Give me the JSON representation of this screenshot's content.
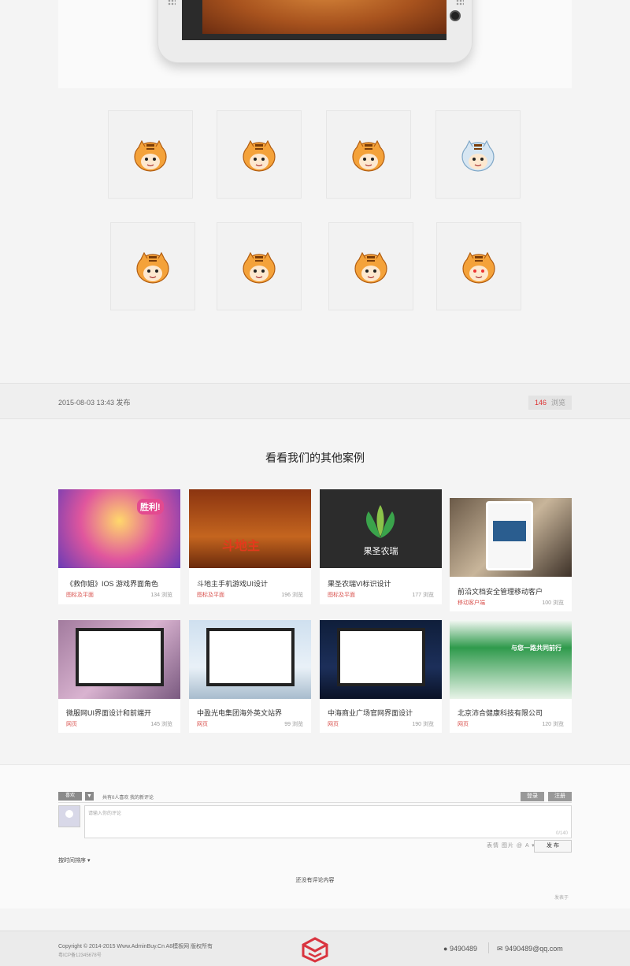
{
  "article": {
    "date": "2015-08-03 13:43 发布",
    "views_count": "146",
    "views_label": "浏览"
  },
  "related": {
    "title": "看看我们的其他案例",
    "cards": [
      {
        "title": "《救你姐》IOS 游戏界面角色",
        "category": "图标及平面",
        "views": "134 浏览",
        "image_text": "胜利!"
      },
      {
        "title": "斗地主手机游戏UI设计",
        "category": "图标及平面",
        "views": "196 浏览",
        "image_text": "斗地主"
      },
      {
        "title": "果圣农瑞VI标识设计",
        "category": "图标及平面",
        "views": "177 浏览",
        "image_text": "果圣农瑞"
      },
      {
        "title": "前沿文档安全管理移动客户",
        "category": "移动客户端",
        "views": "100 浏览",
        "image_text": ""
      },
      {
        "title": "微服网UI界面设计和前端开",
        "category": "网页",
        "views": "145 浏览",
        "image_text": ""
      },
      {
        "title": "中盈光电集团海外英文站界",
        "category": "网页",
        "views": "99 浏览",
        "image_text": ""
      },
      {
        "title": "中海商业广场官网界面设计",
        "category": "网页",
        "views": "190 浏览",
        "image_text": ""
      },
      {
        "title": "北京沛合健康科技有限公司",
        "category": "网页",
        "views": "120 浏览",
        "image_text": "与您一路共同前行"
      }
    ]
  },
  "comments": {
    "like_label": "喜欢",
    "dislike_label": "踩",
    "like_text": "共有0人喜欢  我的新评论",
    "login_label": "登录",
    "register_label": "注册",
    "placeholder": "请输入你的评论",
    "char_count": "0/140",
    "emoji_icons": "表情 图片 @ A ▾",
    "post_label": "发 布",
    "sort_label": "按时间排序 ▾",
    "empty_text": "还没有评论内容",
    "powered": "发表于"
  },
  "footer": {
    "copyright": "Copyright © 2014-2015 Www.AdminBuy.Cn A8模板网 版权所有",
    "icp": "粤ICP备12345678号",
    "qq": "9490489",
    "email": "9490489@qq.com"
  },
  "colors": {
    "accent": "#d9534f",
    "logo": "#d9343f"
  }
}
